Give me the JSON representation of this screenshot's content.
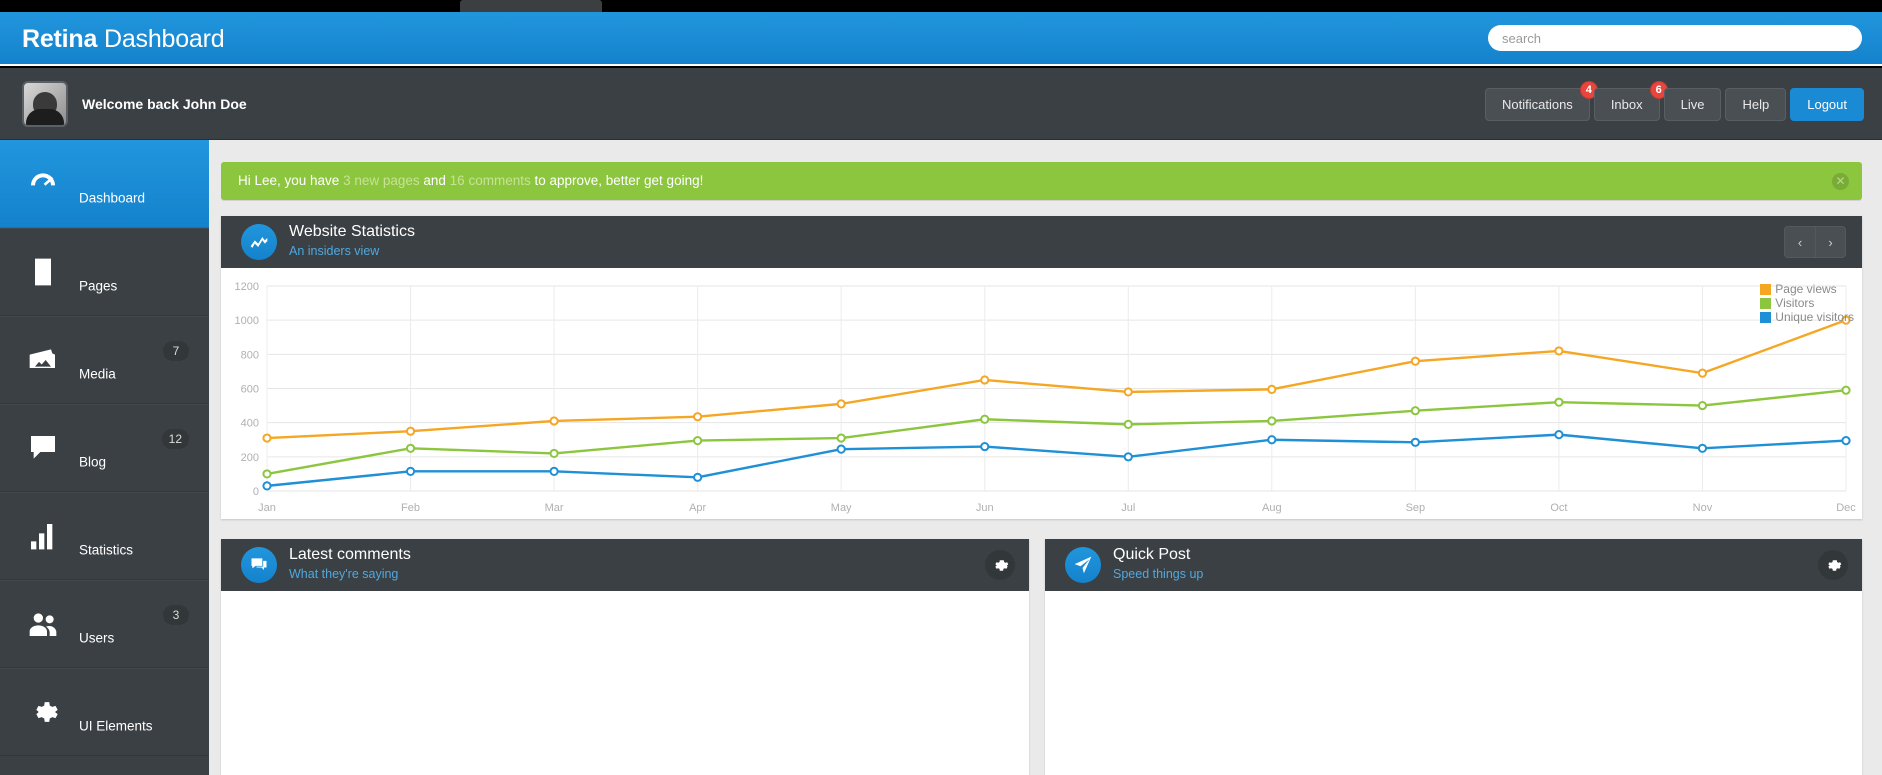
{
  "app": {
    "brand_bold": "Retina",
    "brand_light": " Dashboard"
  },
  "search": {
    "placeholder": "search",
    "value": ""
  },
  "userbar": {
    "welcome": "Welcome back John Doe",
    "buttons": [
      {
        "label": "Notifications",
        "badge": "4",
        "primary": false
      },
      {
        "label": "Inbox",
        "badge": "6",
        "primary": false
      },
      {
        "label": "Live",
        "badge": "",
        "primary": false
      },
      {
        "label": "Help",
        "badge": "",
        "primary": false
      },
      {
        "label": "Logout",
        "badge": "",
        "primary": true
      }
    ]
  },
  "sidebar": {
    "items": [
      {
        "label": "Dashboard",
        "badge": "",
        "icon": "gauge-icon",
        "active": true
      },
      {
        "label": "Pages",
        "badge": "",
        "icon": "document-icon",
        "active": false
      },
      {
        "label": "Media",
        "badge": "7",
        "icon": "image-icon",
        "active": false
      },
      {
        "label": "Blog",
        "badge": "12",
        "icon": "comment-icon",
        "active": false
      },
      {
        "label": "Statistics",
        "badge": "",
        "icon": "bar-chart-icon",
        "active": false
      },
      {
        "label": "Users",
        "badge": "3",
        "icon": "users-icon",
        "active": false
      },
      {
        "label": "UI Elements",
        "badge": "",
        "icon": "gear-icon",
        "active": false
      }
    ]
  },
  "alert": {
    "lead": "Hi Lee, you have ",
    "count_pages": "3 new pages",
    "mid": " and ",
    "count_comments": "16 comments",
    "tail": " to approve, better get going!",
    "close_icon": "close-circle-icon",
    "color": "#8cc63e"
  },
  "panels": {
    "stats": {
      "title": "Website Statistics",
      "subtitle": "An insiders view",
      "icon": "line-chart-icon",
      "prev_label": "‹",
      "next_label": "›"
    },
    "comments": {
      "title": "Latest comments",
      "subtitle": "What they're saying",
      "icon": "comments-icon",
      "gear_icon": "gear-icon"
    },
    "quickpost": {
      "title": "Quick Post",
      "subtitle": "Speed things up",
      "icon": "paper-plane-icon",
      "gear_icon": "gear-icon"
    }
  },
  "chart_data": {
    "type": "line",
    "title": "Website Statistics",
    "xlabel": "",
    "ylabel": "",
    "categories": [
      "Jan",
      "Feb",
      "Mar",
      "Apr",
      "May",
      "Jun",
      "Jul",
      "Aug",
      "Sep",
      "Oct",
      "Nov",
      "Dec"
    ],
    "ylim": [
      0,
      1200
    ],
    "yticks": [
      0,
      200,
      400,
      600,
      800,
      1000,
      1200
    ],
    "grid": true,
    "legend_position": "top-right",
    "series": [
      {
        "name": "Page views",
        "color": "#f5a623",
        "values": [
          310,
          350,
          410,
          435,
          510,
          650,
          580,
          595,
          760,
          820,
          690,
          1000
        ]
      },
      {
        "name": "Visitors",
        "color": "#8cc63e",
        "values": [
          100,
          250,
          220,
          295,
          310,
          420,
          390,
          410,
          470,
          520,
          500,
          590
        ]
      },
      {
        "name": "Unique visitors",
        "color": "#1f8fd6",
        "values": [
          30,
          115,
          115,
          80,
          245,
          260,
          200,
          300,
          285,
          330,
          250,
          295
        ]
      }
    ]
  }
}
